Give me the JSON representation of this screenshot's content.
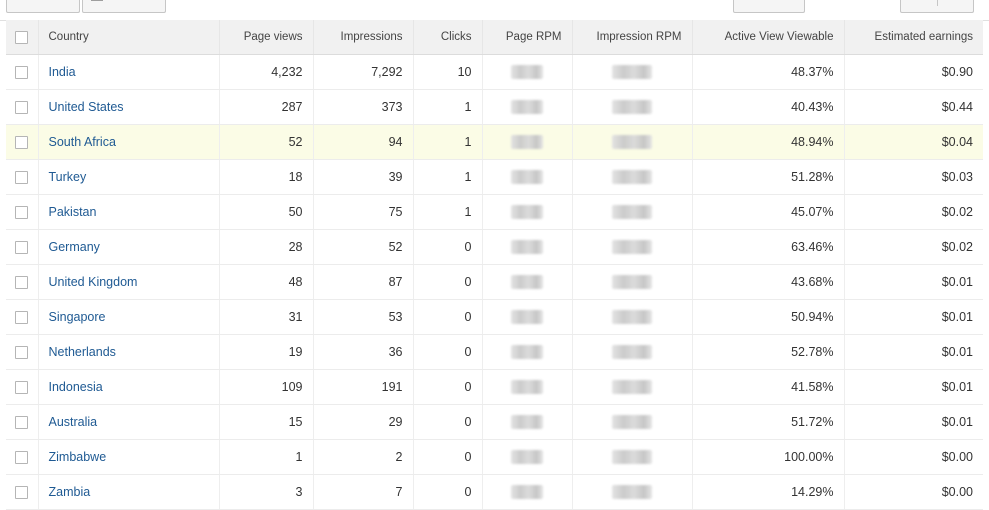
{
  "table": {
    "columns": {
      "country": "Country",
      "page_views": "Page views",
      "impressions": "Impressions",
      "clicks": "Clicks",
      "page_rpm": "Page RPM",
      "impression_rpm": "Impression RPM",
      "active_view": "Active View Viewable",
      "earnings": "Estimated earnings"
    },
    "rows": [
      {
        "country": "India",
        "page_views": "4,232",
        "impressions": "7,292",
        "clicks": "10",
        "active_view": "48.37%",
        "earnings": "$0.90"
      },
      {
        "country": "United States",
        "page_views": "287",
        "impressions": "373",
        "clicks": "1",
        "active_view": "40.43%",
        "earnings": "$0.44"
      },
      {
        "country": "South Africa",
        "page_views": "52",
        "impressions": "94",
        "clicks": "1",
        "active_view": "48.94%",
        "earnings": "$0.04"
      },
      {
        "country": "Turkey",
        "page_views": "18",
        "impressions": "39",
        "clicks": "1",
        "active_view": "51.28%",
        "earnings": "$0.03"
      },
      {
        "country": "Pakistan",
        "page_views": "50",
        "impressions": "75",
        "clicks": "1",
        "active_view": "45.07%",
        "earnings": "$0.02"
      },
      {
        "country": "Germany",
        "page_views": "28",
        "impressions": "52",
        "clicks": "0",
        "active_view": "63.46%",
        "earnings": "$0.02"
      },
      {
        "country": "United Kingdom",
        "page_views": "48",
        "impressions": "87",
        "clicks": "0",
        "active_view": "43.68%",
        "earnings": "$0.01"
      },
      {
        "country": "Singapore",
        "page_views": "31",
        "impressions": "53",
        "clicks": "0",
        "active_view": "50.94%",
        "earnings": "$0.01"
      },
      {
        "country": "Netherlands",
        "page_views": "19",
        "impressions": "36",
        "clicks": "0",
        "active_view": "52.78%",
        "earnings": "$0.01"
      },
      {
        "country": "Indonesia",
        "page_views": "109",
        "impressions": "191",
        "clicks": "0",
        "active_view": "41.58%",
        "earnings": "$0.01"
      },
      {
        "country": "Australia",
        "page_views": "15",
        "impressions": "29",
        "clicks": "0",
        "active_view": "51.72%",
        "earnings": "$0.01"
      },
      {
        "country": "Zimbabwe",
        "page_views": "1",
        "impressions": "2",
        "clicks": "0",
        "active_view": "100.00%",
        "earnings": "$0.00"
      },
      {
        "country": "Zambia",
        "page_views": "3",
        "impressions": "7",
        "clicks": "0",
        "active_view": "14.29%",
        "earnings": "$0.00"
      }
    ]
  },
  "colors": {
    "link": "#1f5a93",
    "header_bg": "#f1f1f1",
    "highlight_row": "#fbfce6"
  },
  "icons": {
    "row_select": "checkbox-icon",
    "redacted": "blurred-value"
  }
}
